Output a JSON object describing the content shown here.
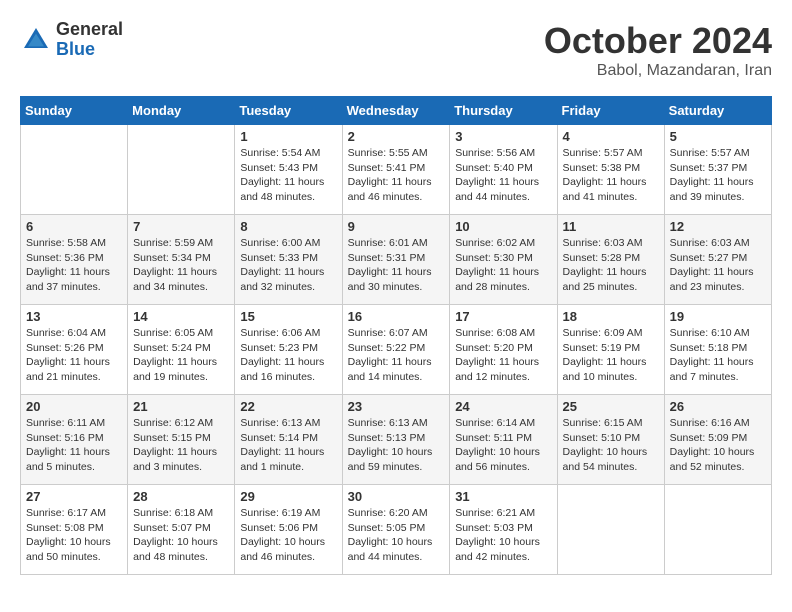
{
  "logo": {
    "general": "General",
    "blue": "Blue"
  },
  "title": "October 2024",
  "location": "Babol, Mazandaran, Iran",
  "days_header": [
    "Sunday",
    "Monday",
    "Tuesday",
    "Wednesday",
    "Thursday",
    "Friday",
    "Saturday"
  ],
  "weeks": [
    [
      {
        "day": "",
        "info": ""
      },
      {
        "day": "",
        "info": ""
      },
      {
        "day": "1",
        "sunrise": "5:54 AM",
        "sunset": "5:43 PM",
        "daylight": "11 hours and 48 minutes."
      },
      {
        "day": "2",
        "sunrise": "5:55 AM",
        "sunset": "5:41 PM",
        "daylight": "11 hours and 46 minutes."
      },
      {
        "day": "3",
        "sunrise": "5:56 AM",
        "sunset": "5:40 PM",
        "daylight": "11 hours and 44 minutes."
      },
      {
        "day": "4",
        "sunrise": "5:57 AM",
        "sunset": "5:38 PM",
        "daylight": "11 hours and 41 minutes."
      },
      {
        "day": "5",
        "sunrise": "5:57 AM",
        "sunset": "5:37 PM",
        "daylight": "11 hours and 39 minutes."
      }
    ],
    [
      {
        "day": "6",
        "sunrise": "5:58 AM",
        "sunset": "5:36 PM",
        "daylight": "11 hours and 37 minutes."
      },
      {
        "day": "7",
        "sunrise": "5:59 AM",
        "sunset": "5:34 PM",
        "daylight": "11 hours and 34 minutes."
      },
      {
        "day": "8",
        "sunrise": "6:00 AM",
        "sunset": "5:33 PM",
        "daylight": "11 hours and 32 minutes."
      },
      {
        "day": "9",
        "sunrise": "6:01 AM",
        "sunset": "5:31 PM",
        "daylight": "11 hours and 30 minutes."
      },
      {
        "day": "10",
        "sunrise": "6:02 AM",
        "sunset": "5:30 PM",
        "daylight": "11 hours and 28 minutes."
      },
      {
        "day": "11",
        "sunrise": "6:03 AM",
        "sunset": "5:28 PM",
        "daylight": "11 hours and 25 minutes."
      },
      {
        "day": "12",
        "sunrise": "6:03 AM",
        "sunset": "5:27 PM",
        "daylight": "11 hours and 23 minutes."
      }
    ],
    [
      {
        "day": "13",
        "sunrise": "6:04 AM",
        "sunset": "5:26 PM",
        "daylight": "11 hours and 21 minutes."
      },
      {
        "day": "14",
        "sunrise": "6:05 AM",
        "sunset": "5:24 PM",
        "daylight": "11 hours and 19 minutes."
      },
      {
        "day": "15",
        "sunrise": "6:06 AM",
        "sunset": "5:23 PM",
        "daylight": "11 hours and 16 minutes."
      },
      {
        "day": "16",
        "sunrise": "6:07 AM",
        "sunset": "5:22 PM",
        "daylight": "11 hours and 14 minutes."
      },
      {
        "day": "17",
        "sunrise": "6:08 AM",
        "sunset": "5:20 PM",
        "daylight": "11 hours and 12 minutes."
      },
      {
        "day": "18",
        "sunrise": "6:09 AM",
        "sunset": "5:19 PM",
        "daylight": "11 hours and 10 minutes."
      },
      {
        "day": "19",
        "sunrise": "6:10 AM",
        "sunset": "5:18 PM",
        "daylight": "11 hours and 7 minutes."
      }
    ],
    [
      {
        "day": "20",
        "sunrise": "6:11 AM",
        "sunset": "5:16 PM",
        "daylight": "11 hours and 5 minutes."
      },
      {
        "day": "21",
        "sunrise": "6:12 AM",
        "sunset": "5:15 PM",
        "daylight": "11 hours and 3 minutes."
      },
      {
        "day": "22",
        "sunrise": "6:13 AM",
        "sunset": "5:14 PM",
        "daylight": "11 hours and 1 minute."
      },
      {
        "day": "23",
        "sunrise": "6:13 AM",
        "sunset": "5:13 PM",
        "daylight": "10 hours and 59 minutes."
      },
      {
        "day": "24",
        "sunrise": "6:14 AM",
        "sunset": "5:11 PM",
        "daylight": "10 hours and 56 minutes."
      },
      {
        "day": "25",
        "sunrise": "6:15 AM",
        "sunset": "5:10 PM",
        "daylight": "10 hours and 54 minutes."
      },
      {
        "day": "26",
        "sunrise": "6:16 AM",
        "sunset": "5:09 PM",
        "daylight": "10 hours and 52 minutes."
      }
    ],
    [
      {
        "day": "27",
        "sunrise": "6:17 AM",
        "sunset": "5:08 PM",
        "daylight": "10 hours and 50 minutes."
      },
      {
        "day": "28",
        "sunrise": "6:18 AM",
        "sunset": "5:07 PM",
        "daylight": "10 hours and 48 minutes."
      },
      {
        "day": "29",
        "sunrise": "6:19 AM",
        "sunset": "5:06 PM",
        "daylight": "10 hours and 46 minutes."
      },
      {
        "day": "30",
        "sunrise": "6:20 AM",
        "sunset": "5:05 PM",
        "daylight": "10 hours and 44 minutes."
      },
      {
        "day": "31",
        "sunrise": "6:21 AM",
        "sunset": "5:03 PM",
        "daylight": "10 hours and 42 minutes."
      },
      {
        "day": "",
        "info": ""
      },
      {
        "day": "",
        "info": ""
      }
    ]
  ]
}
